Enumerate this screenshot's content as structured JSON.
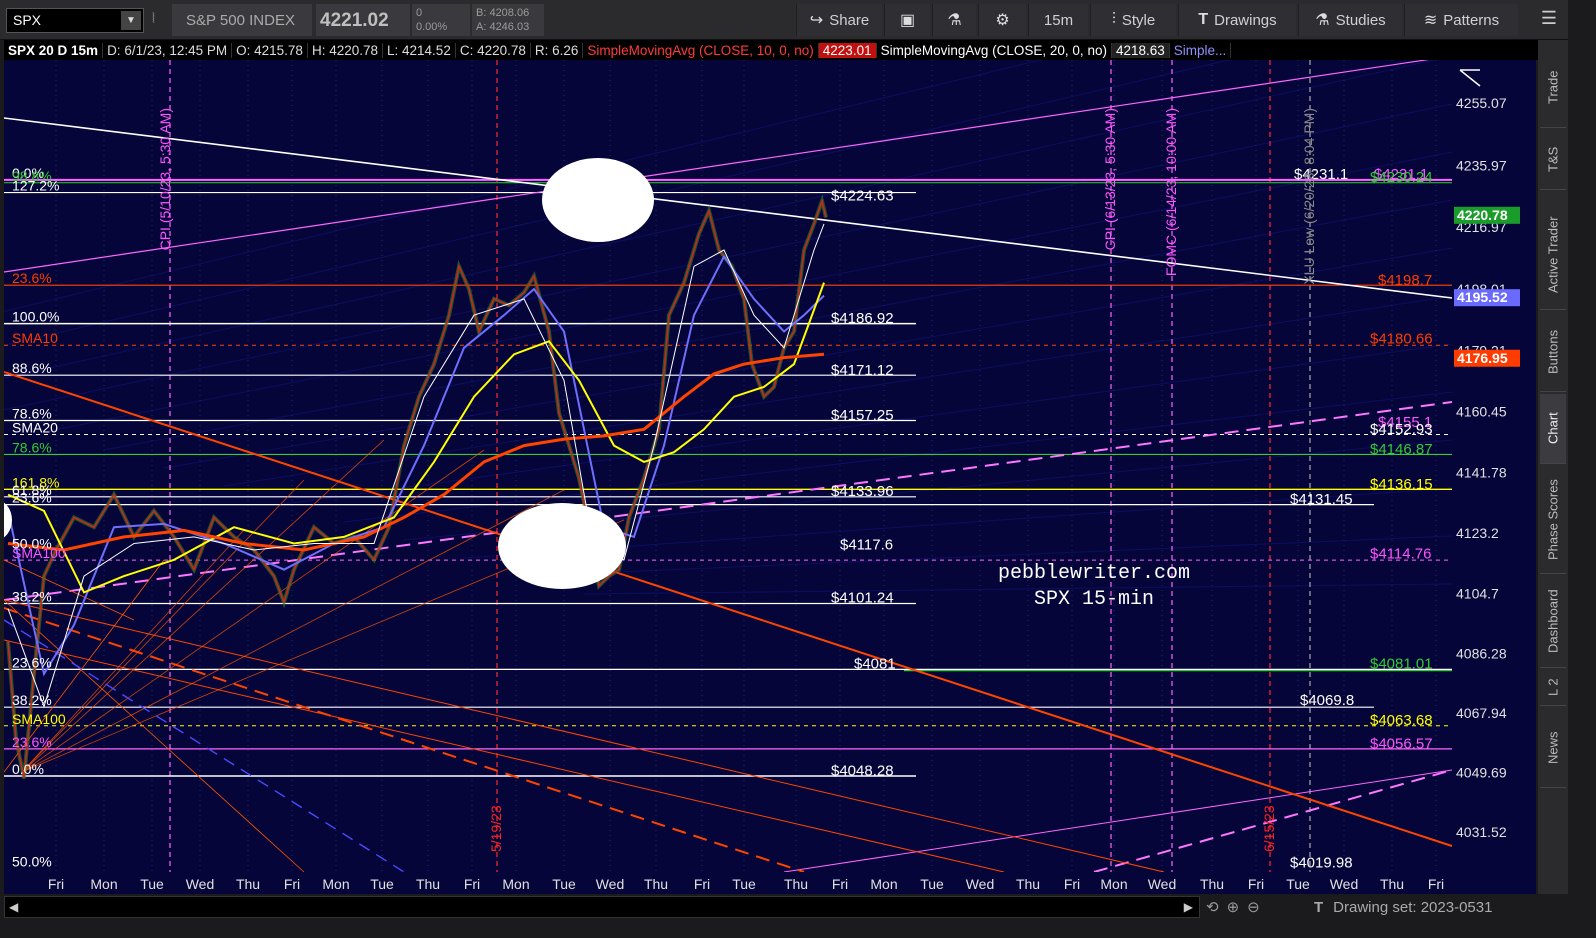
{
  "toolbar": {
    "symbol": "SPX",
    "description": "S&P 500 INDEX",
    "last": "4221.02",
    "change": "0",
    "change_pct": "0.00%",
    "bid": "B: 4208.06",
    "ask": "A: 4246.03",
    "share_label": "Share",
    "timeframe_label": "15m",
    "style_label": "Style",
    "drawings_label": "Drawings",
    "studies_label": "Studies",
    "patterns_label": "Patterns"
  },
  "info": {
    "title": "SPX 20 D 15m",
    "date": "D: 6/1/23, 12:45 PM",
    "open": "O: 4215.78",
    "high": "H: 4220.78",
    "low": "L: 4214.52",
    "close": "C: 4220.78",
    "range": "R: 6.26",
    "sma10_label": "SimpleMovingAvg (CLOSE, 10, 0, no)",
    "sma10_value": "4223.01",
    "sma20_label": "SimpleMovingAvg (CLOSE, 20, 0, no)",
    "sma20_value": "4218.63",
    "sma_more": "Simple..."
  },
  "chart_data": {
    "type": "line",
    "symbol": "SPX",
    "price_axis_ticks": [
      "4255.07",
      "4235.97",
      "4216.97",
      "4198.01",
      "4179.21",
      "4160.45",
      "4141.78",
      "4123.2",
      "4104.7",
      "4086.28",
      "4067.94",
      "4049.69",
      "4031.52"
    ],
    "x_labels": [
      "Fri",
      "Mon",
      "Tue",
      "Wed",
      "Thu",
      "Fri",
      "Mon",
      "Tue",
      "Thu",
      "Fri",
      "Mon",
      "Tue",
      "Wed",
      "Thu",
      "Fri",
      "Tue",
      "Thu",
      "Fri",
      "Mon",
      "Tue",
      "Wed",
      "Thu",
      "Fri",
      "Mon",
      "Wed",
      "Thu",
      "Fri",
      "Tue",
      "Wed",
      "Thu",
      "Fri"
    ],
    "price_badges": [
      {
        "text": "4220.78",
        "color": "#1a9c2a",
        "price": 4220.78
      },
      {
        "text": "4195.52",
        "color": "#6a6aff",
        "price": 4195.52
      },
      {
        "text": "4176.95",
        "color": "#ff3b00",
        "price": 4176.95
      }
    ],
    "level_labels": [
      {
        "text": "$4224.63",
        "price": 4224.63,
        "color": "#ffffff"
      },
      {
        "text": "$4186.92",
        "price": 4186.92,
        "color": "#ffffff"
      },
      {
        "text": "$4171.12",
        "price": 4171.12,
        "color": "#ffffff"
      },
      {
        "text": "$4157.25",
        "price": 4157.25,
        "color": "#ffffff"
      },
      {
        "text": "$4133.96",
        "price": 4133.96,
        "color": "#ffffff"
      },
      {
        "text": "$4117.6",
        "price": 4117.6,
        "color": "#ffffff"
      },
      {
        "text": "$4101.24",
        "price": 4101.24,
        "color": "#ffffff"
      },
      {
        "text": "$4081",
        "price": 4081,
        "color": "#ffffff"
      },
      {
        "text": "$4048.28",
        "price": 4048.28,
        "color": "#ffffff"
      }
    ],
    "right_labels": [
      {
        "text": "$4231.1",
        "price": 4231.1,
        "color": "#ff55ff"
      },
      {
        "text": "$4230.24",
        "price": 4230.24,
        "color": "#33cc33"
      },
      {
        "text": "$4231.1",
        "price": 4231.1,
        "color": "#ffffff"
      },
      {
        "text": "$4198.7",
        "price": 4198.7,
        "color": "#ff3b00"
      },
      {
        "text": "$4180.66",
        "price": 4180.66,
        "color": "#ff3b00"
      },
      {
        "text": "$4155.1",
        "price": 4155.1,
        "color": "#ff55ff"
      },
      {
        "text": "$4152.93",
        "price": 4152.93,
        "color": "#ffffff"
      },
      {
        "text": "$4146.87",
        "price": 4146.87,
        "color": "#33cc33"
      },
      {
        "text": "$4136.15",
        "price": 4136.15,
        "color": "#ffff00"
      },
      {
        "text": "$4131.45",
        "price": 4131.45,
        "color": "#ffffff"
      },
      {
        "text": "$4114.76",
        "price": 4114.76,
        "color": "#ff55ff"
      },
      {
        "text": "$4081.01",
        "price": 4081.01,
        "color": "#33cc33"
      },
      {
        "text": "$4069.8",
        "price": 4069.8,
        "color": "#ffffff"
      },
      {
        "text": "$4063.68",
        "price": 4063.68,
        "color": "#ffff00"
      },
      {
        "text": "$4056.57",
        "price": 4056.57,
        "color": "#ff55ff"
      },
      {
        "text": "$4019.98",
        "price": 4019.98,
        "color": "#ffffff"
      }
    ],
    "fib_labels": [
      {
        "text": "0.0%",
        "price": 4231.5,
        "color": "#ffffff"
      },
      {
        "text": "98.8%",
        "price": 4230.6,
        "color": "#33cc33"
      },
      {
        "text": "127.2%",
        "price": 4227.6,
        "color": "#ffffff"
      },
      {
        "text": "23.6%",
        "price": 4199.2,
        "color": "#ff3b00"
      },
      {
        "text": "100.0%",
        "price": 4187.4,
        "color": "#ffffff"
      },
      {
        "text": "SMA10",
        "price": 4180.8,
        "color": "#ff3b00"
      },
      {
        "text": "88.6%",
        "price": 4171.6,
        "color": "#ffffff"
      },
      {
        "text": "78.6%",
        "price": 4157.7,
        "color": "#ffffff"
      },
      {
        "text": "SMA20",
        "price": 4153.4,
        "color": "#ffffff"
      },
      {
        "text": "78.6%",
        "price": 4147.3,
        "color": "#33cc33"
      },
      {
        "text": "161.8%",
        "price": 4136.6,
        "color": "#ffff00"
      },
      {
        "text": "61.8%",
        "price": 4134.3,
        "color": "#ffffff"
      },
      {
        "text": "23.6%",
        "price": 4131.9,
        "color": "#ffffff"
      },
      {
        "text": "50.0%",
        "price": 4117.9,
        "color": "#ffffff"
      },
      {
        "text": "SMA100",
        "price": 4114.9,
        "color": "#ff55ff"
      },
      {
        "text": "38.2%",
        "price": 4101.6,
        "color": "#ffffff"
      },
      {
        "text": "23.6%",
        "price": 4081.4,
        "color": "#ffffff"
      },
      {
        "text": "38.2%",
        "price": 4069.8,
        "color": "#ffffff"
      },
      {
        "text": "SMA100",
        "price": 4064.1,
        "color": "#ffff00"
      },
      {
        "text": "23.6%",
        "price": 4057.0,
        "color": "#ff55ff"
      },
      {
        "text": "0.0%",
        "price": 4048.7,
        "color": "#ffffff"
      },
      {
        "text": "50.0%",
        "price": 4020.3,
        "color": "#ffffff"
      }
    ],
    "vertical_notes": [
      {
        "text": "CPI (5/10/23, 5:30 AM)",
        "color": "#ff55ff"
      },
      {
        "text": "5/19/23",
        "color": "#ff2222"
      },
      {
        "text": "CPI (6/13/23, 5:30 AM)",
        "color": "#ff55ff"
      },
      {
        "text": "FOMC (6/14/23, 10:00 AM)",
        "color": "#ff55ff"
      },
      {
        "text": "XLU Low (6/20/23, 8:04 PM)",
        "color": "#888888"
      },
      {
        "text": "6/15/23",
        "color": "#ff2222"
      }
    ],
    "watermark_line1": "pebblewriter.com",
    "watermark_line2": "SPX 15-min"
  },
  "sidebar": {
    "tabs": [
      "Trade",
      "T&S",
      "Active Trader",
      "Buttons",
      "Chart",
      "Phase Scores",
      "Dashboard",
      "L 2",
      "News"
    ]
  },
  "bottom": {
    "drawing_set": "Drawing set: 2023-0531"
  }
}
